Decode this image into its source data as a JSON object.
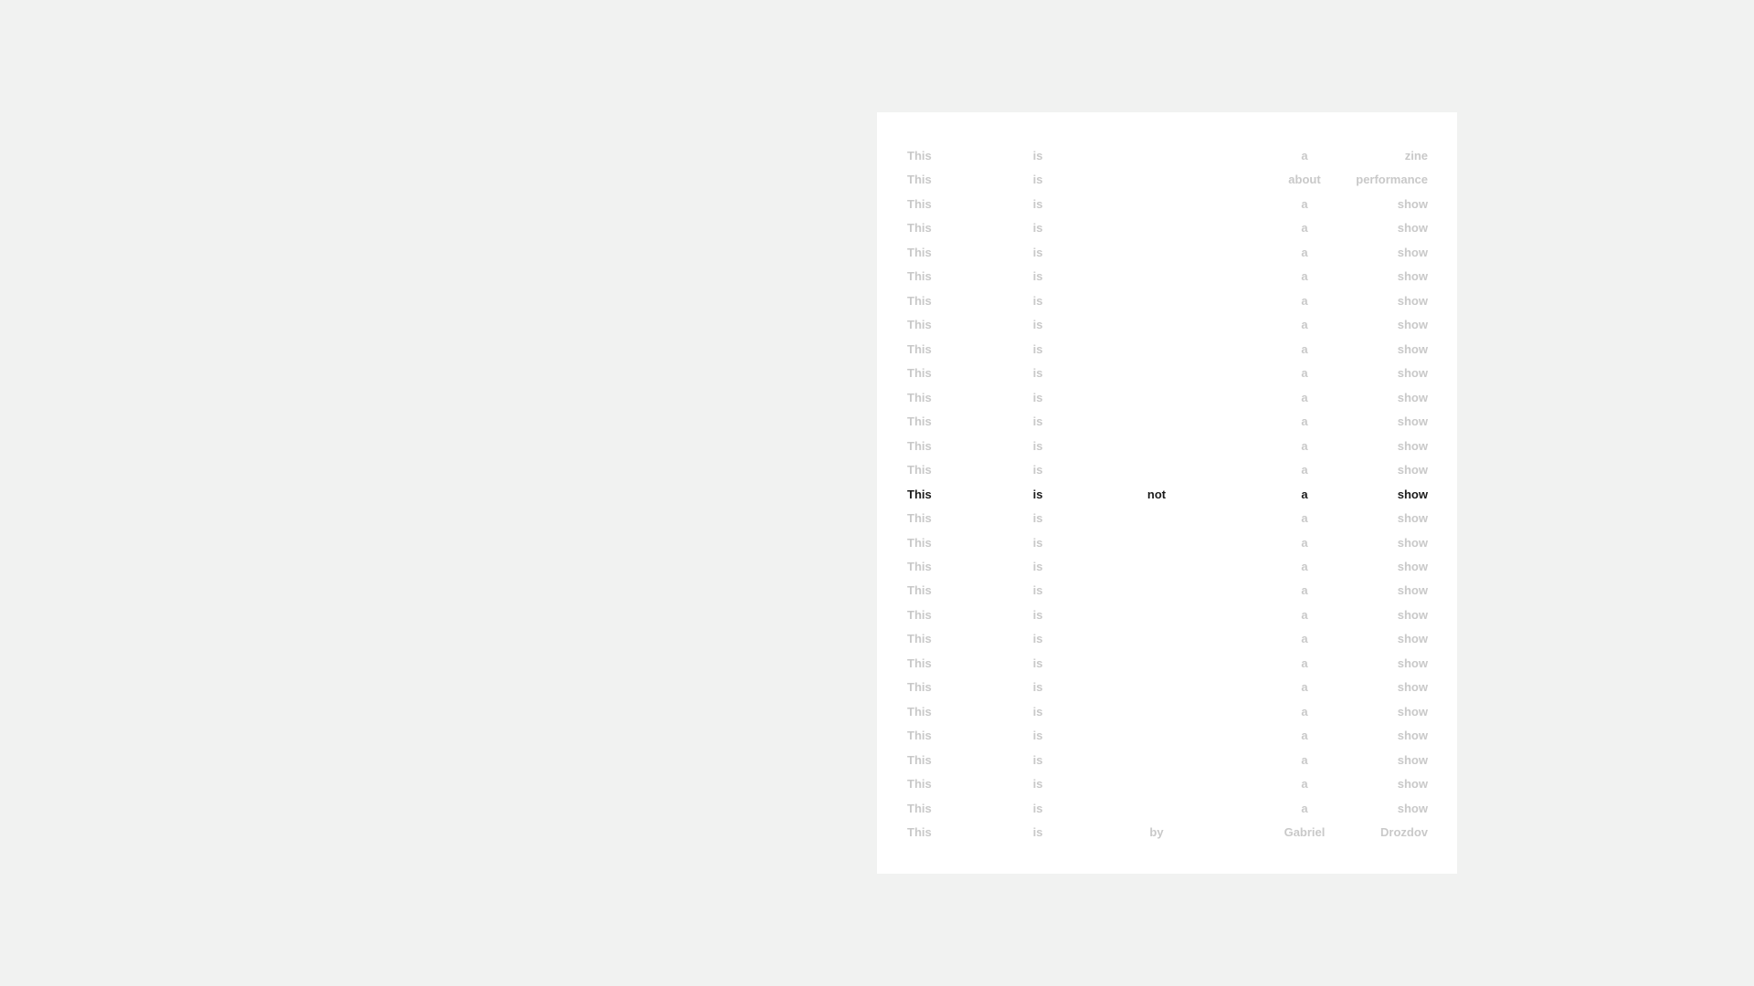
{
  "rows": [
    {
      "c1": "This",
      "c2": "is",
      "c3": "",
      "c4": "a",
      "c5": "zine",
      "highlight": false
    },
    {
      "c1": "This",
      "c2": "is",
      "c3": "",
      "c4": "about",
      "c5": "performance",
      "highlight": false
    },
    {
      "c1": "This",
      "c2": "is",
      "c3": "",
      "c4": "a",
      "c5": "show",
      "highlight": false
    },
    {
      "c1": "This",
      "c2": "is",
      "c3": "",
      "c4": "a",
      "c5": "show",
      "highlight": false
    },
    {
      "c1": "This",
      "c2": "is",
      "c3": "",
      "c4": "a",
      "c5": "show",
      "highlight": false
    },
    {
      "c1": "This",
      "c2": "is",
      "c3": "",
      "c4": "a",
      "c5": "show",
      "highlight": false
    },
    {
      "c1": "This",
      "c2": "is",
      "c3": "",
      "c4": "a",
      "c5": "show",
      "highlight": false
    },
    {
      "c1": "This",
      "c2": "is",
      "c3": "",
      "c4": "a",
      "c5": "show",
      "highlight": false
    },
    {
      "c1": "This",
      "c2": "is",
      "c3": "",
      "c4": "a",
      "c5": "show",
      "highlight": false
    },
    {
      "c1": "This",
      "c2": "is",
      "c3": "",
      "c4": "a",
      "c5": "show",
      "highlight": false
    },
    {
      "c1": "This",
      "c2": "is",
      "c3": "",
      "c4": "a",
      "c5": "show",
      "highlight": false
    },
    {
      "c1": "This",
      "c2": "is",
      "c3": "",
      "c4": "a",
      "c5": "show",
      "highlight": false
    },
    {
      "c1": "This",
      "c2": "is",
      "c3": "",
      "c4": "a",
      "c5": "show",
      "highlight": false
    },
    {
      "c1": "This",
      "c2": "is",
      "c3": "",
      "c4": "a",
      "c5": "show",
      "highlight": false
    },
    {
      "c1": "This",
      "c2": "is",
      "c3": "not",
      "c4": "a",
      "c5": "show",
      "highlight": true
    },
    {
      "c1": "This",
      "c2": "is",
      "c3": "",
      "c4": "a",
      "c5": "show",
      "highlight": false
    },
    {
      "c1": "This",
      "c2": "is",
      "c3": "",
      "c4": "a",
      "c5": "show",
      "highlight": false
    },
    {
      "c1": "This",
      "c2": "is",
      "c3": "",
      "c4": "a",
      "c5": "show",
      "highlight": false
    },
    {
      "c1": "This",
      "c2": "is",
      "c3": "",
      "c4": "a",
      "c5": "show",
      "highlight": false
    },
    {
      "c1": "This",
      "c2": "is",
      "c3": "",
      "c4": "a",
      "c5": "show",
      "highlight": false
    },
    {
      "c1": "This",
      "c2": "is",
      "c3": "",
      "c4": "a",
      "c5": "show",
      "highlight": false
    },
    {
      "c1": "This",
      "c2": "is",
      "c3": "",
      "c4": "a",
      "c5": "show",
      "highlight": false
    },
    {
      "c1": "This",
      "c2": "is",
      "c3": "",
      "c4": "a",
      "c5": "show",
      "highlight": false
    },
    {
      "c1": "This",
      "c2": "is",
      "c3": "",
      "c4": "a",
      "c5": "show",
      "highlight": false
    },
    {
      "c1": "This",
      "c2": "is",
      "c3": "",
      "c4": "a",
      "c5": "show",
      "highlight": false
    },
    {
      "c1": "This",
      "c2": "is",
      "c3": "",
      "c4": "a",
      "c5": "show",
      "highlight": false
    },
    {
      "c1": "This",
      "c2": "is",
      "c3": "",
      "c4": "a",
      "c5": "show",
      "highlight": false
    },
    {
      "c1": "This",
      "c2": "is",
      "c3": "",
      "c4": "a",
      "c5": "show",
      "highlight": false
    },
    {
      "c1": "This",
      "c2": "is",
      "c3": "by",
      "c4": "Gabriel",
      "c5": "Drozdov",
      "highlight": false
    }
  ],
  "colors": {
    "background": "#f1f2f1",
    "page": "#ffffff",
    "text_muted": "#c9c9c9",
    "text_highlight": "#1c1c1c"
  }
}
